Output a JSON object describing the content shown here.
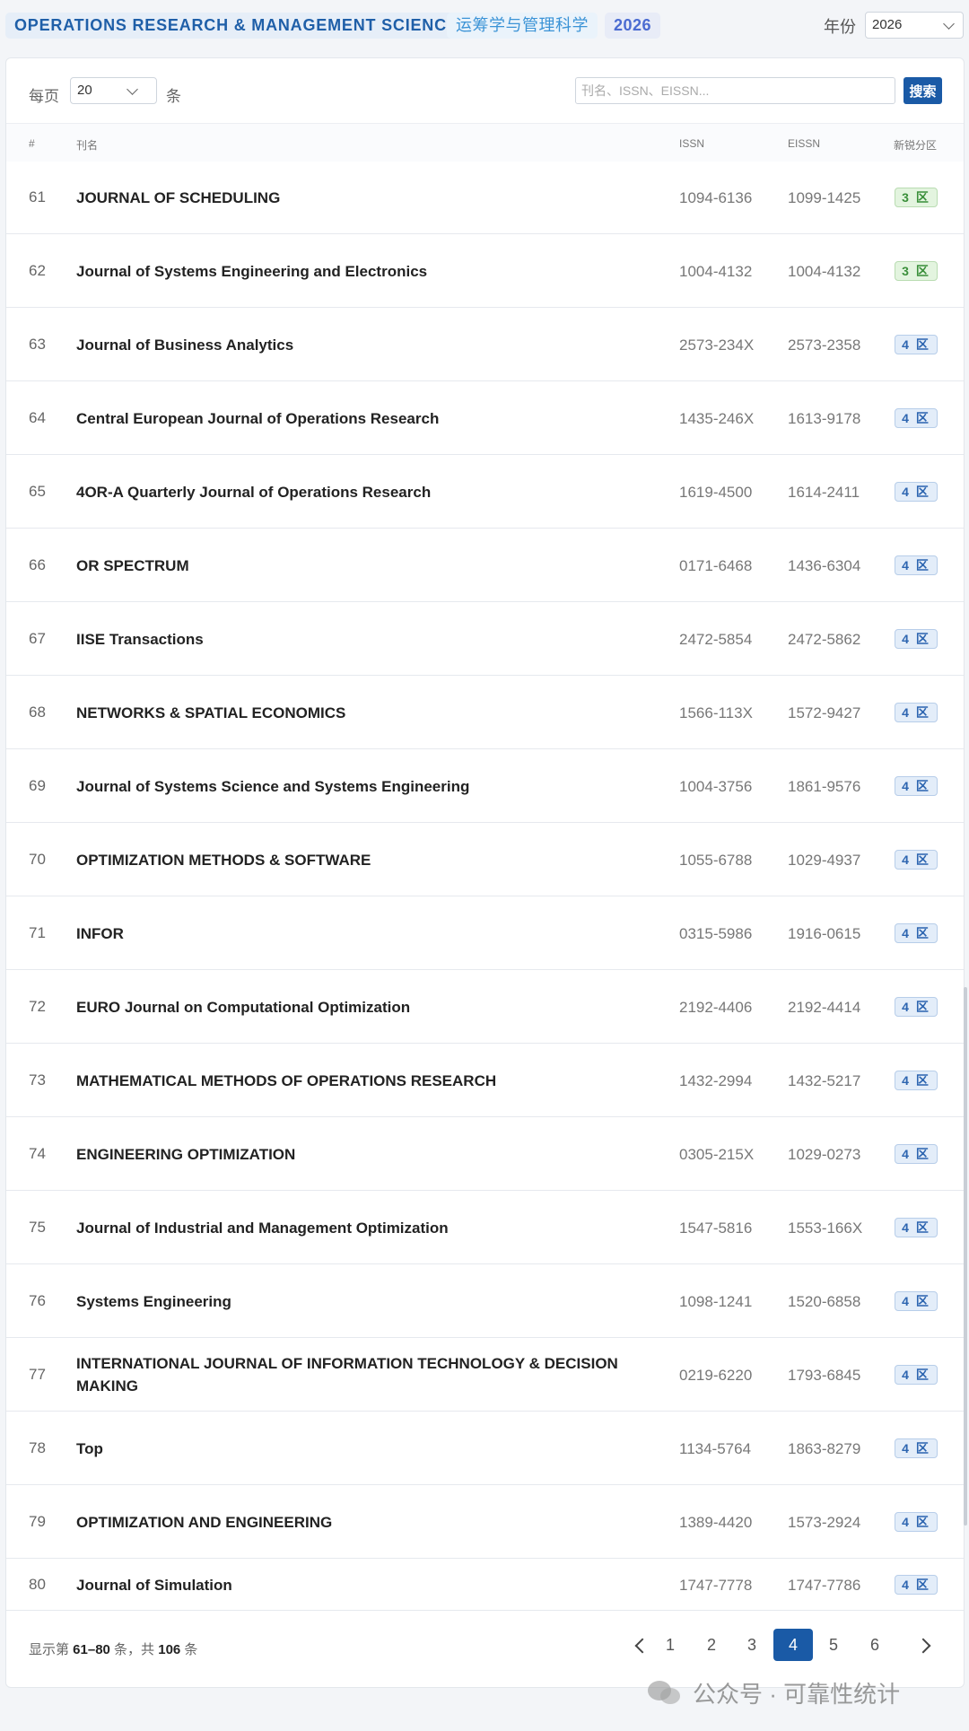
{
  "header": {
    "category_en": "OPERATIONS RESEARCH & MANAGEMENT SCIENCE",
    "category_zh": "运筹学与管理科学",
    "year_tag": "2026",
    "year_label": "年份",
    "year_value": "2026"
  },
  "toolbar": {
    "per_page_label": "每页",
    "per_page_value": "20",
    "per_page_unit": "条",
    "search_placeholder": "刊名、ISSN、EISSN...",
    "search_button": "搜索"
  },
  "table": {
    "columns": {
      "num": "#",
      "name": "刊名",
      "issn": "ISSN",
      "eissn": "EISSN",
      "zone": "新锐分区"
    },
    "rows": [
      {
        "num": "61",
        "name": "JOURNAL OF SCHEDULING",
        "issn": "1094-6136",
        "eissn": "1099-1425",
        "zone": "3 区",
        "level": 3
      },
      {
        "num": "62",
        "name": "Journal of Systems Engineering and Electronics",
        "issn": "1004-4132",
        "eissn": "1004-4132",
        "zone": "3 区",
        "level": 3
      },
      {
        "num": "63",
        "name": "Journal of Business Analytics",
        "issn": "2573-234X",
        "eissn": "2573-2358",
        "zone": "4 区",
        "level": 4
      },
      {
        "num": "64",
        "name": "Central European Journal of Operations Research",
        "issn": "1435-246X",
        "eissn": "1613-9178",
        "zone": "4 区",
        "level": 4
      },
      {
        "num": "65",
        "name": "4OR-A Quarterly Journal of Operations Research",
        "issn": "1619-4500",
        "eissn": "1614-2411",
        "zone": "4 区",
        "level": 4
      },
      {
        "num": "66",
        "name": "OR SPECTRUM",
        "issn": "0171-6468",
        "eissn": "1436-6304",
        "zone": "4 区",
        "level": 4
      },
      {
        "num": "67",
        "name": "IISE Transactions",
        "issn": "2472-5854",
        "eissn": "2472-5862",
        "zone": "4 区",
        "level": 4
      },
      {
        "num": "68",
        "name": "NETWORKS & SPATIAL ECONOMICS",
        "issn": "1566-113X",
        "eissn": "1572-9427",
        "zone": "4 区",
        "level": 4
      },
      {
        "num": "69",
        "name": "Journal of Systems Science and Systems Engineering",
        "issn": "1004-3756",
        "eissn": "1861-9576",
        "zone": "4 区",
        "level": 4
      },
      {
        "num": "70",
        "name": "OPTIMIZATION METHODS & SOFTWARE",
        "issn": "1055-6788",
        "eissn": "1029-4937",
        "zone": "4 区",
        "level": 4
      },
      {
        "num": "71",
        "name": "INFOR",
        "issn": "0315-5986",
        "eissn": "1916-0615",
        "zone": "4 区",
        "level": 4
      },
      {
        "num": "72",
        "name": "EURO Journal on Computational Optimization",
        "issn": "2192-4406",
        "eissn": "2192-4414",
        "zone": "4 区",
        "level": 4
      },
      {
        "num": "73",
        "name": "MATHEMATICAL METHODS OF OPERATIONS RESEARCH",
        "issn": "1432-2994",
        "eissn": "1432-5217",
        "zone": "4 区",
        "level": 4
      },
      {
        "num": "74",
        "name": "ENGINEERING OPTIMIZATION",
        "issn": "0305-215X",
        "eissn": "1029-0273",
        "zone": "4 区",
        "level": 4
      },
      {
        "num": "75",
        "name": "Journal of Industrial and Management Optimization",
        "issn": "1547-5816",
        "eissn": "1553-166X",
        "zone": "4 区",
        "level": 4
      },
      {
        "num": "76",
        "name": "Systems Engineering",
        "issn": "1098-1241",
        "eissn": "1520-6858",
        "zone": "4 区",
        "level": 4
      },
      {
        "num": "77",
        "name": "INTERNATIONAL JOURNAL OF INFORMATION TECHNOLOGY & DECISION MAKING",
        "issn": "0219-6220",
        "eissn": "1793-6845",
        "zone": "4 区",
        "level": 4
      },
      {
        "num": "78",
        "name": "Top",
        "issn": "1134-5764",
        "eissn": "1863-8279",
        "zone": "4 区",
        "level": 4
      },
      {
        "num": "79",
        "name": "OPTIMIZATION AND ENGINEERING",
        "issn": "1389-4420",
        "eissn": "1573-2924",
        "zone": "4 区",
        "level": 4
      },
      {
        "num": "80",
        "name": "Journal of Simulation",
        "issn": "1747-7778",
        "eissn": "1747-7786",
        "zone": "4 区",
        "level": 4
      }
    ]
  },
  "footer": {
    "summary_prefix": "显示第 ",
    "range": "61–80",
    "summary_mid": " 条，共 ",
    "total": "106",
    "summary_suffix": " 条",
    "pages": [
      "1",
      "2",
      "3",
      "4",
      "5",
      "6"
    ],
    "current_page": "4"
  },
  "watermark": "公众号 · 可靠性统计",
  "colors": {
    "accent": "#1a5aa6",
    "zone3": "#3a8f3a",
    "zone4": "#2d65b0"
  }
}
